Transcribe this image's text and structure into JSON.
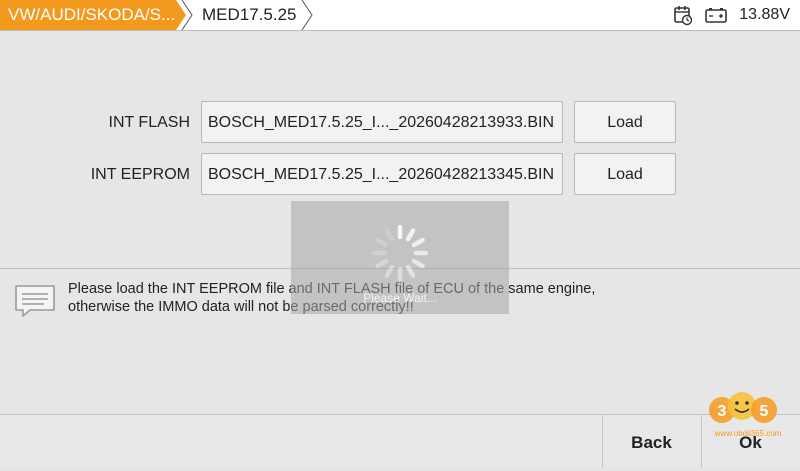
{
  "header": {
    "breadcrumb_active": "VW/AUDI/SKODA/S...",
    "breadcrumb_current": "MED17.5.25",
    "voltage": "13.88V",
    "icons": {
      "schedule": "calendar-clock-icon",
      "battery": "battery-icon"
    }
  },
  "rows": [
    {
      "label": "INT FLASH",
      "file": "BOSCH_MED17.5.25_I..._20260428213933.BIN",
      "button": "Load"
    },
    {
      "label": "INT EEPROM",
      "file": "BOSCH_MED17.5.25_I..._20260428213345.BIN",
      "button": "Load"
    }
  ],
  "loading": {
    "text": "Please Wait..."
  },
  "message": {
    "icon": "message-icon",
    "line1": "Please load the INT EEPROM file and INT FLASH file of ECU of the same engine,",
    "line2": "otherwise the IMMO data will not be parsed correctly!!"
  },
  "footer": {
    "back_label": "Back",
    "ok_label": "Ok"
  },
  "watermark": {
    "text": "www.obdii365.com",
    "logo": "365"
  },
  "colors": {
    "accent": "#f39a1e",
    "background": "#e6e6e6"
  }
}
